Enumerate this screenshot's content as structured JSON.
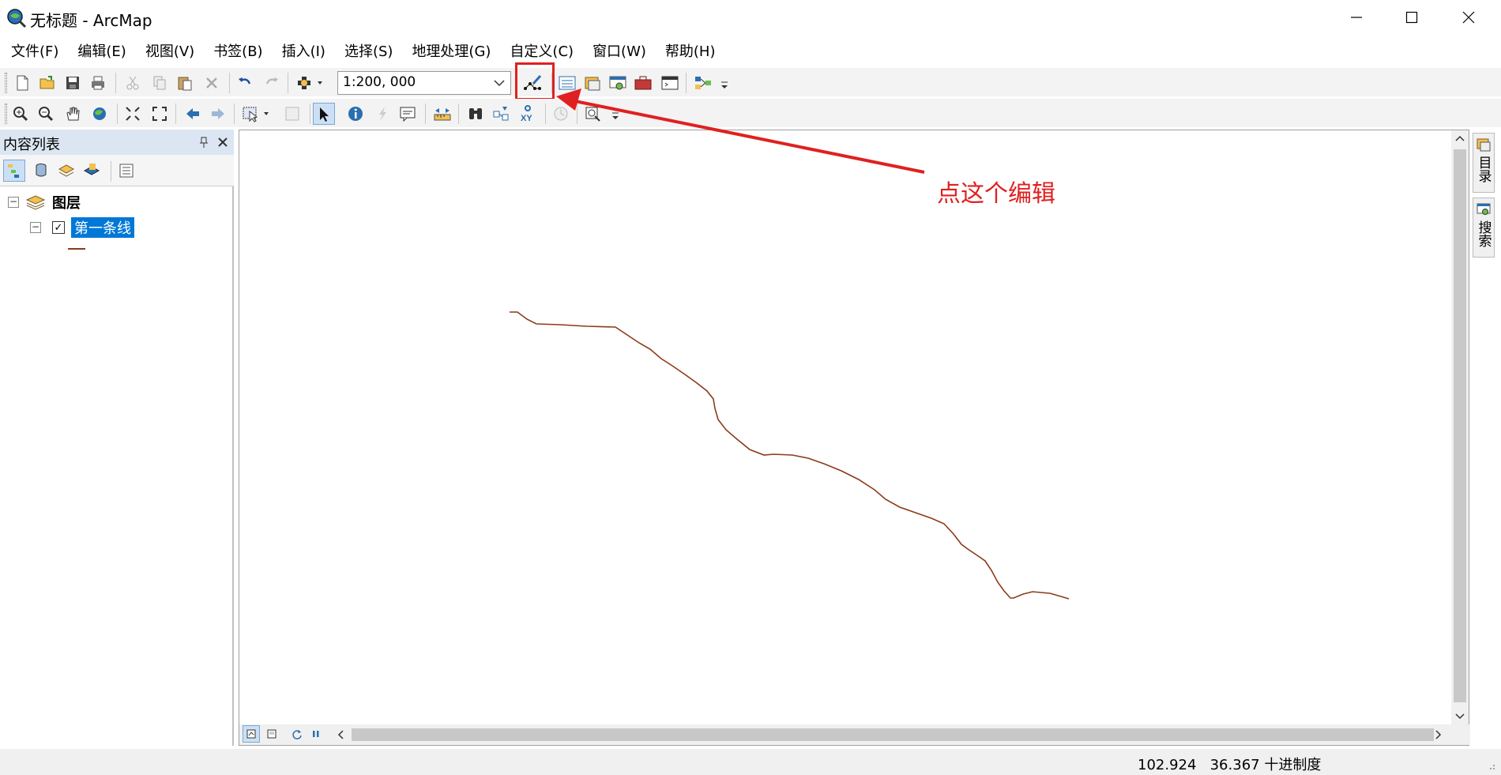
{
  "window": {
    "title": "无标题 - ArcMap",
    "controls": [
      "minimize-icon",
      "maximize-icon",
      "close-icon"
    ]
  },
  "menu": {
    "items": [
      "文件(F)",
      "编辑(E)",
      "视图(V)",
      "书签(B)",
      "插入(I)",
      "选择(S)",
      "地理处理(G)",
      "自定义(C)",
      "窗口(W)",
      "帮助(H)"
    ]
  },
  "toolbar": {
    "scale": "1:200, 000",
    "standard_icons": [
      "new-document-icon",
      "open-folder-icon",
      "save-icon",
      "print-icon",
      "cut-icon",
      "copy-icon",
      "paste-icon",
      "delete-icon",
      "undo-icon",
      "redo-icon",
      "add-data-icon",
      "editor-toolbar-icon",
      "table-of-contents-icon",
      "catalog-icon",
      "search-window-icon",
      "arctoolbox-icon",
      "python-window-icon",
      "model-builder-icon"
    ],
    "tools_icons": [
      "zoom-in-icon",
      "zoom-out-icon",
      "pan-icon",
      "full-extent-icon",
      "fixed-zoom-in-icon",
      "fixed-zoom-out-icon",
      "back-extent-icon",
      "forward-extent-icon",
      "select-features-icon",
      "clear-selection-icon",
      "select-elements-icon",
      "identify-icon",
      "hyperlink-icon",
      "html-popup-icon",
      "measure-icon",
      "find-icon",
      "find-route-icon",
      "go-to-xy-icon",
      "time-slider-icon",
      "magnifier-icon"
    ]
  },
  "toc": {
    "title": "内容列表",
    "layers_group": "图层",
    "layer_name": "第一条线",
    "layer_checked": true
  },
  "dock": {
    "tabs": [
      "目录",
      "搜索"
    ]
  },
  "status": {
    "x": "102.924",
    "y": "36.367",
    "units": "十进制度"
  },
  "annotation": {
    "text": "点这个编辑",
    "color": "#e02020"
  },
  "colors": {
    "line_feature": "#8b3a1a",
    "selection": "#0078d7",
    "annotation": "#e02020"
  }
}
